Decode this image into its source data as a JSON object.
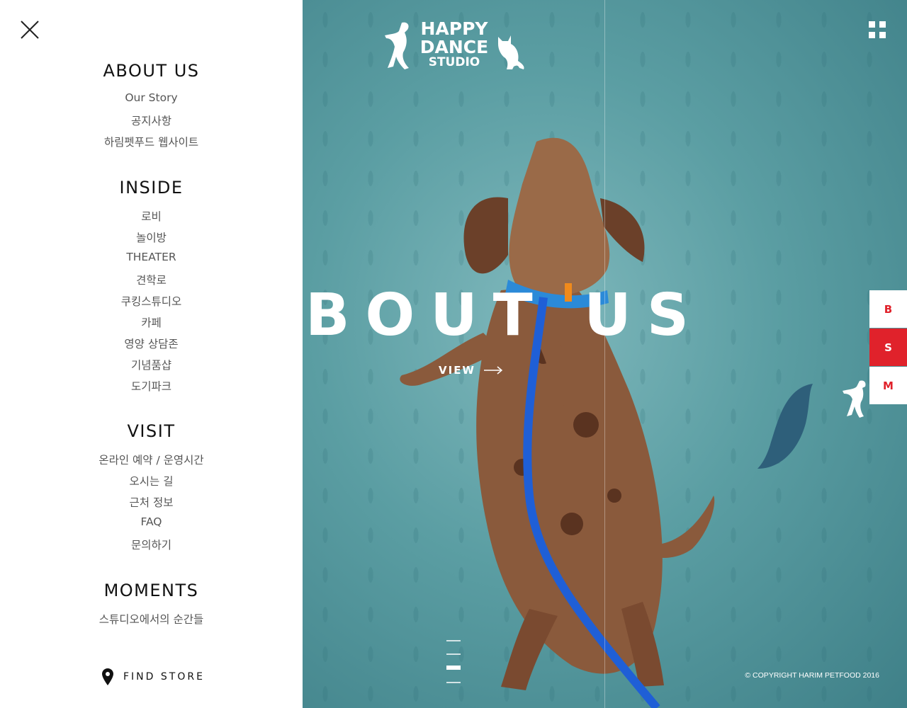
{
  "menu": {
    "sections": [
      {
        "title": "ABOUT US",
        "items": [
          "Our Story",
          "공지사항",
          "하림펫푸드 웹사이트"
        ]
      },
      {
        "title": "INSIDE",
        "items": [
          "로비",
          "놀이방",
          "THEATER",
          "견학로",
          "쿠킹스튜디오",
          "카페",
          "영양 상담존",
          "기념품샵",
          "도기파크"
        ]
      },
      {
        "title": "VISIT",
        "items": [
          "온라인 예약 /  운영시간",
          "오시는 길",
          "근처 정보",
          "FAQ",
          "문의하기"
        ]
      },
      {
        "title": "MOMENTS",
        "items": [
          "스튜디오에서의 순간들"
        ]
      }
    ],
    "find_store": "FIND STORE"
  },
  "logo": {
    "line1": "HAPPY",
    "line2": "DANCE",
    "line3": "STUDIO"
  },
  "hero": {
    "title": "BOUT US",
    "view_label": "VIEW"
  },
  "side_buttons": [
    {
      "label": "B",
      "active": false
    },
    {
      "label": "S",
      "active": true
    },
    {
      "label": "M",
      "active": false
    }
  ],
  "copyright": "© COPYRIGHT HARIM PETFOOD 2016",
  "colors": {
    "accent": "#e0222b",
    "teal": "#5b9ea3",
    "leash": "#1f5fd6",
    "leaf": "#2e5f7a"
  }
}
